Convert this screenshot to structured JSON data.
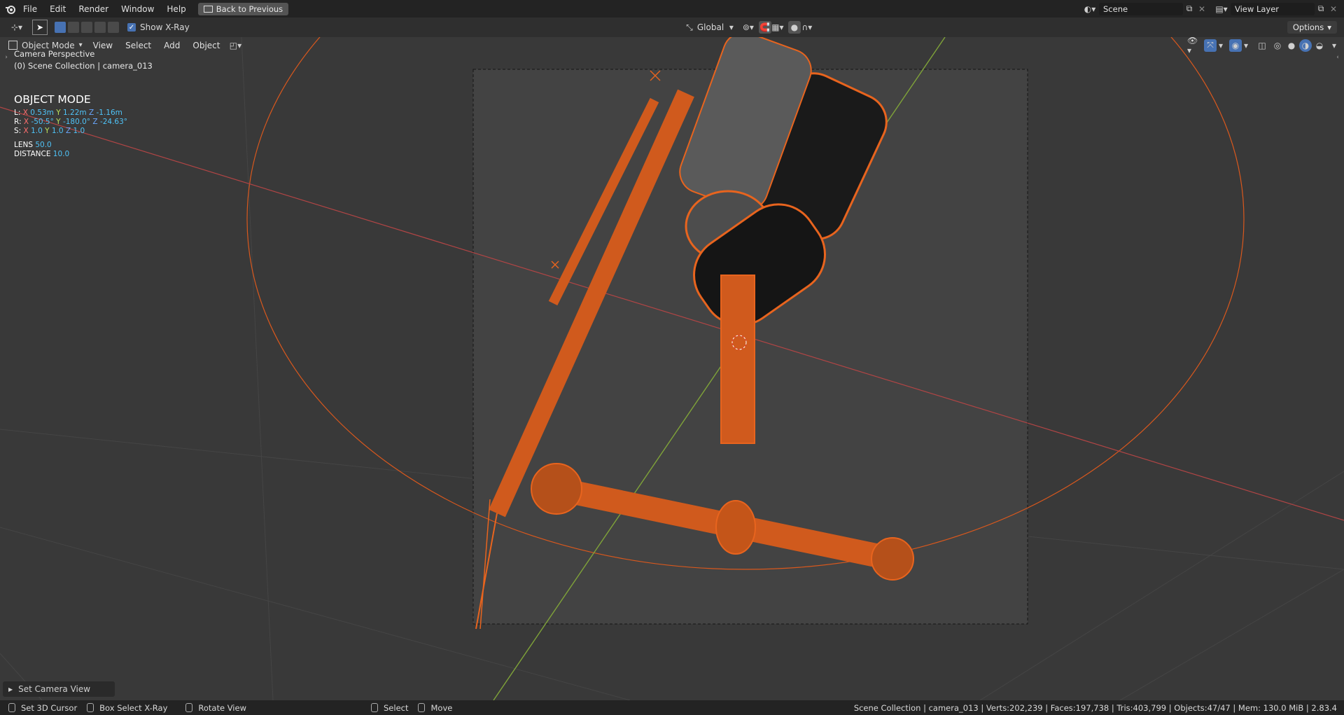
{
  "topbar": {
    "menus": [
      "File",
      "Edit",
      "Render",
      "Window",
      "Help"
    ],
    "back_button": "Back to Previous",
    "scene": "Scene",
    "view_layer": "View Layer"
  },
  "toolheader": {
    "show_xray": "Show X-Ray",
    "orientation": "Global",
    "options": "Options"
  },
  "viewheader": {
    "mode": "Object Mode",
    "menus": [
      "View",
      "Select",
      "Add",
      "Object"
    ]
  },
  "overlay": {
    "view_name": "Camera Perspective",
    "collection": "(0) Scene Collection | camera_013",
    "mode_title": "OBJECT MODE",
    "location": {
      "label": "L:",
      "x": "0.53m",
      "y": "1.22m",
      "z": "-1.16m"
    },
    "rotation": {
      "label": "R:",
      "x": "-50.5°",
      "y": "-180.0°",
      "z": "-24.63°"
    },
    "scale": {
      "label": "S:",
      "x": "1.0",
      "y": "1.0",
      "z": "1.0"
    },
    "lens_label": "LENS",
    "lens_value": "50.0",
    "distance_label": "DISTANCE",
    "distance_value": "10.0"
  },
  "last_operator": "Set Camera View",
  "status": {
    "left_action": "Set 3D Cursor",
    "middle_action": "Box Select X-Ray",
    "right_action": "Rotate View",
    "select": "Select",
    "move": "Move",
    "stats": "Scene Collection | camera_013 | Verts:202,239 | Faces:197,738 | Tris:403,799 | Objects:47/47 | Mem: 130.0 MiB | 2.83.4"
  },
  "colors": {
    "selection_orange": "#e8641e",
    "x_axis": "#b14545",
    "y_axis": "#7fa339",
    "accent_blue": "#4772b3"
  }
}
